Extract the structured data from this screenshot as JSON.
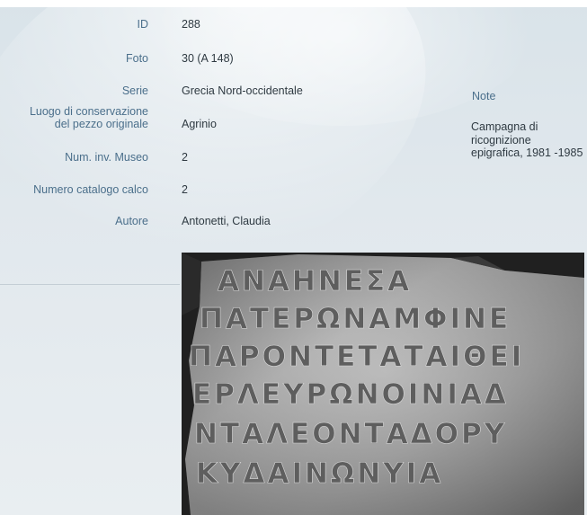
{
  "record": {
    "fields": [
      {
        "label": "ID",
        "value": "288"
      },
      {
        "label": "Foto",
        "value": "30 (A 148)"
      },
      {
        "label": "Serie",
        "value": "Grecia Nord-occidentale"
      },
      {
        "label": "Luogo di conservazione\ndel pezzo originale",
        "value": "Agrinio"
      },
      {
        "label": "Num. inv. Museo",
        "value": "2"
      },
      {
        "label": "Numero catalogo calco",
        "value": "2"
      },
      {
        "label": "Autore",
        "value": "Antonetti, Claudia"
      }
    ]
  },
  "note": {
    "title": "Note",
    "text": "Campagna di ricognizione epigrafica, 1981 -1985"
  },
  "photo": {
    "inscription_lines": [
      "ΑΝΑΗΝΕΣΑ",
      "ΠΑΤΕΡΩΝΑΜΦΙΝΕ",
      "ΠΑΡΟΝΤΕΤΑΤΑΙΘΕΙ",
      "ΕΡΛΕΥΡΩΝΟΙΝΙΑΔ",
      "ΝΤΑΛΕΟΝΤΑΔΟΡΥ",
      "ΚΥΔΑΙΝΩΝΥΙΑ"
    ]
  },
  "colors": {
    "label": "#4b6f8b",
    "value": "#2f3a42",
    "background": "#dfe7ec"
  }
}
